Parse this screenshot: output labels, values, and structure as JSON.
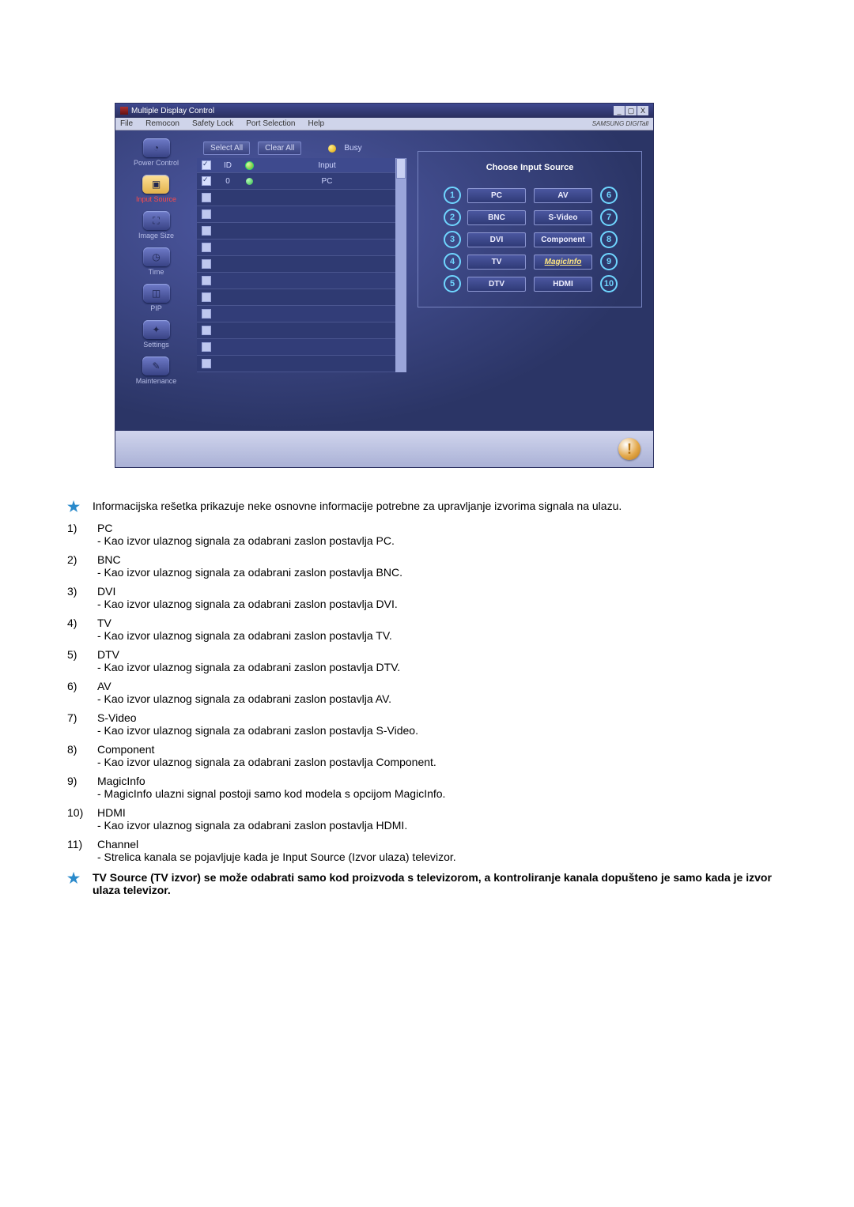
{
  "app": {
    "title": "Multiple Display Control",
    "menu": [
      "File",
      "Remocon",
      "Safety Lock",
      "Port Selection",
      "Help"
    ],
    "brand": "SAMSUNG DIGITall",
    "win_controls": {
      "min": "_",
      "max": "▢",
      "close": "X"
    }
  },
  "sidebar": {
    "items": [
      {
        "label": "Power Control",
        "icon": "power-icon"
      },
      {
        "label": "Input Source",
        "icon": "input-icon",
        "active": true
      },
      {
        "label": "Image Size",
        "icon": "imagesize-icon"
      },
      {
        "label": "Time",
        "icon": "time-icon"
      },
      {
        "label": "PIP",
        "icon": "pip-icon"
      },
      {
        "label": "Settings",
        "icon": "settings-icon"
      },
      {
        "label": "Maintenance",
        "icon": "maintenance-icon"
      }
    ]
  },
  "toolbar": {
    "select_all": "Select All",
    "clear_all": "Clear All",
    "busy_label": "Busy"
  },
  "grid": {
    "headers": {
      "id": "ID",
      "input": "Input"
    },
    "rows": [
      {
        "checked": true,
        "id": "0",
        "status": true,
        "input": "PC"
      },
      {
        "checked": false,
        "id": "",
        "status": false,
        "input": ""
      },
      {
        "checked": false,
        "id": "",
        "status": false,
        "input": ""
      },
      {
        "checked": false,
        "id": "",
        "status": false,
        "input": ""
      },
      {
        "checked": false,
        "id": "",
        "status": false,
        "input": ""
      },
      {
        "checked": false,
        "id": "",
        "status": false,
        "input": ""
      },
      {
        "checked": false,
        "id": "",
        "status": false,
        "input": ""
      },
      {
        "checked": false,
        "id": "",
        "status": false,
        "input": ""
      },
      {
        "checked": false,
        "id": "",
        "status": false,
        "input": ""
      },
      {
        "checked": false,
        "id": "",
        "status": false,
        "input": ""
      },
      {
        "checked": false,
        "id": "",
        "status": false,
        "input": ""
      },
      {
        "checked": false,
        "id": "",
        "status": false,
        "input": ""
      }
    ]
  },
  "source_panel": {
    "title": "Choose Input Source",
    "left": [
      {
        "callout": "1",
        "label": "PC"
      },
      {
        "callout": "2",
        "label": "BNC"
      },
      {
        "callout": "3",
        "label": "DVI"
      },
      {
        "callout": "4",
        "label": "TV"
      },
      {
        "callout": "5",
        "label": "DTV"
      }
    ],
    "right": [
      {
        "callout": "6",
        "label": "AV"
      },
      {
        "callout": "7",
        "label": "S-Video"
      },
      {
        "callout": "8",
        "label": "Component"
      },
      {
        "callout": "9",
        "label": "MagicInfo",
        "magic": true
      },
      {
        "callout": "10",
        "label": "HDMI"
      }
    ]
  },
  "text": {
    "intro_note": "Informacijska rešetka prikazuje neke osnovne informacije potrebne za upravljanje izvorima signala na ulazu.",
    "items": [
      {
        "num": "1)",
        "title": "PC",
        "desc": "- Kao izvor ulaznog signala za odabrani zaslon postavlja PC."
      },
      {
        "num": "2)",
        "title": "BNC",
        "desc": "- Kao izvor ulaznog signala za odabrani zaslon postavlja BNC."
      },
      {
        "num": "3)",
        "title": "DVI",
        "desc": "- Kao izvor ulaznog signala za odabrani zaslon postavlja DVI."
      },
      {
        "num": "4)",
        "title": "TV",
        "desc": "- Kao izvor ulaznog signala za odabrani zaslon postavlja TV."
      },
      {
        "num": "5)",
        "title": "DTV",
        "desc": "- Kao izvor ulaznog signala za odabrani zaslon postavlja DTV."
      },
      {
        "num": "6)",
        "title": "AV",
        "desc": "- Kao izvor ulaznog signala za odabrani zaslon postavlja AV."
      },
      {
        "num": "7)",
        "title": "S-Video",
        "desc": "- Kao izvor ulaznog signala za odabrani zaslon postavlja S-Video."
      },
      {
        "num": "8)",
        "title": "Component",
        "desc": "- Kao izvor ulaznog signala za odabrani zaslon postavlja Component."
      },
      {
        "num": "9)",
        "title": "MagicInfo",
        "desc": "- MagicInfo ulazni signal postoji samo kod modela s opcijom MagicInfo."
      },
      {
        "num": "10)",
        "title": "HDMI",
        "desc": "- Kao izvor ulaznog signala za odabrani zaslon postavlja HDMI."
      },
      {
        "num": "11)",
        "title": "Channel",
        "desc": "- Strelica kanala se pojavljuje kada je Input Source (Izvor ulaza) televizor."
      }
    ],
    "bold_note": "TV Source (TV izvor) se može odabrati samo kod proizvoda s televizorom, a kontroliranje kanala dopušteno je samo kada je izvor ulaza televizor."
  }
}
